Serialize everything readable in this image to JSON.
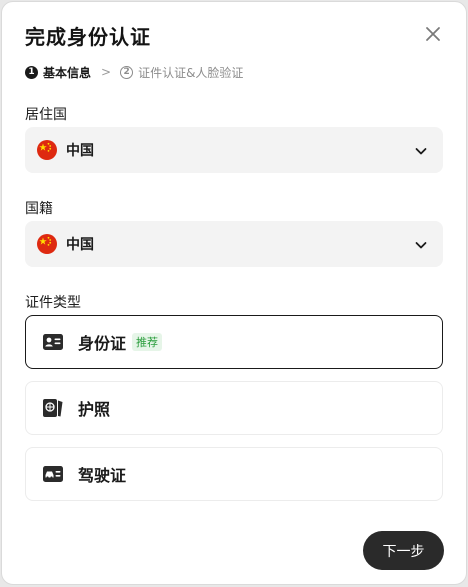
{
  "dialog": {
    "title": "完成身份认证",
    "close_icon": "close-icon"
  },
  "steps": [
    {
      "number": "1",
      "label": "基本信息",
      "state": "active"
    },
    {
      "number": "2",
      "label": "证件认证&人脸验证",
      "state": "inactive"
    }
  ],
  "step_separator": ">",
  "residence": {
    "label": "居住国",
    "value": "中国",
    "flag_icon": "china-flag-icon"
  },
  "nationality": {
    "label": "国籍",
    "value": "中国",
    "flag_icon": "china-flag-icon"
  },
  "document_type": {
    "label": "证件类型",
    "options": [
      {
        "label": "身份证",
        "badge": "推荐",
        "icon": "id-card-icon",
        "selected": true
      },
      {
        "label": "护照",
        "icon": "passport-icon",
        "selected": false
      },
      {
        "label": "驾驶证",
        "icon": "driver-license-icon",
        "selected": false
      }
    ]
  },
  "footer": {
    "next_label": "下一步"
  },
  "colors": {
    "primary_button": "#2a2a2a",
    "badge_green": "#2a9d3c",
    "flag_red": "#de2910"
  }
}
